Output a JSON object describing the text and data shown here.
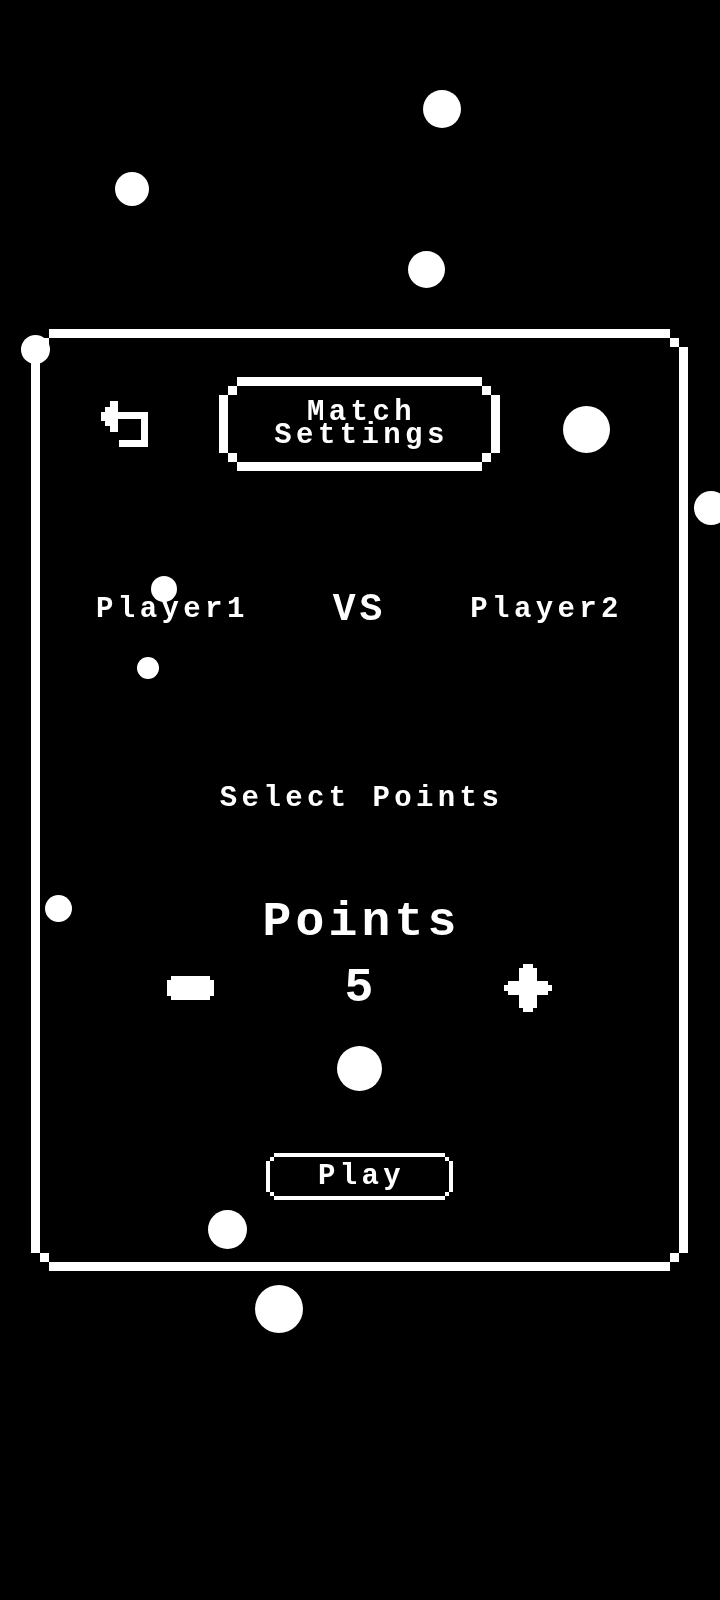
{
  "header": {
    "title": "Match Settings"
  },
  "matchup": {
    "player_1": "Player1",
    "separator": "VS",
    "player_2": "Player2"
  },
  "points": {
    "heading": "Select Points",
    "label": "Points",
    "value": "5"
  },
  "play_button": {
    "label": "Play"
  }
}
